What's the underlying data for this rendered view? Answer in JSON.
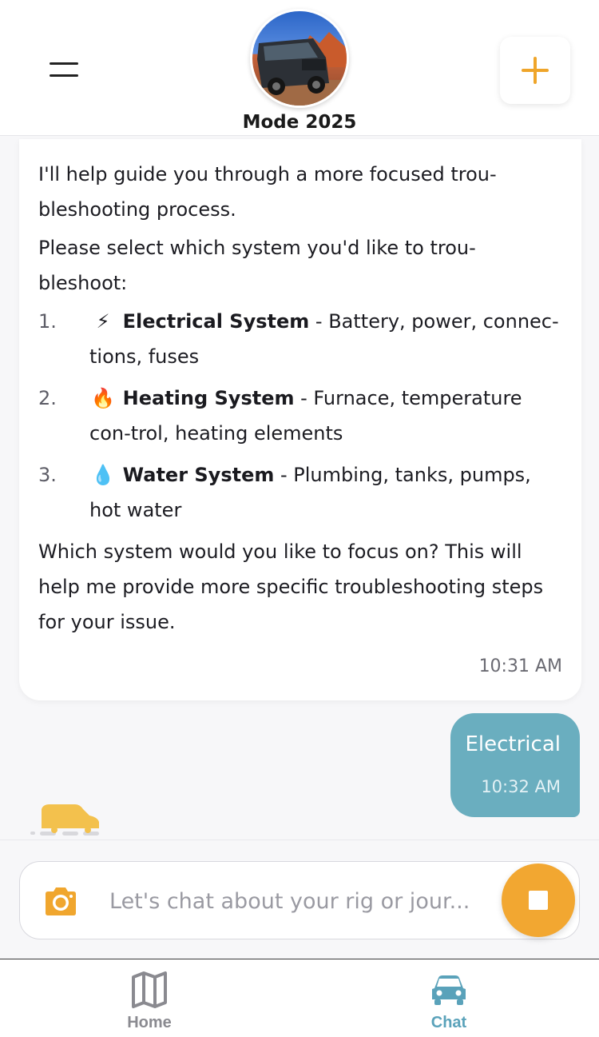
{
  "header": {
    "vehicle_name": "Mode 2025",
    "menu_icon": "hamburger-menu-icon",
    "add_icon": "plus-icon",
    "accent_color": "#efa52a"
  },
  "messages": {
    "bot": {
      "intro": "I'll help guide you through a more focused trou-bleshooting process.",
      "prompt": "Please select which system you'd like to trou-bleshoot:",
      "options": [
        {
          "number": "1.",
          "emoji": "⚡",
          "title": "Electrical System",
          "desc": " - Battery, power, connec-tions, fuses"
        },
        {
          "number": "2.",
          "emoji": "🔥",
          "title": "Heating System",
          "desc": " - Furnace, temperature con-trol, heating elements"
        },
        {
          "number": "3.",
          "emoji": "💧",
          "title": "Water System",
          "desc": " - Plumbing, tanks, pumps, hot water"
        }
      ],
      "closing": "Which system would you like to focus on? This will help me provide more specific troubleshooting steps for your issue.",
      "time": "10:31 AM"
    },
    "user": {
      "text": "Electrical",
      "time": "10:32 AM",
      "bubble_color": "#6aaebf"
    },
    "typing_indicator_icon": "vehicle-typing-icon"
  },
  "composer": {
    "placeholder": "Let's chat about your rig or jour...",
    "camera_icon": "camera-icon",
    "stop_icon": "stop-icon",
    "stop_color": "#f2a731"
  },
  "tabs": [
    {
      "label": "Home",
      "icon": "map-icon",
      "active": false
    },
    {
      "label": "Chat",
      "icon": "car-icon",
      "active": true,
      "active_color": "#5aa2ba"
    }
  ]
}
